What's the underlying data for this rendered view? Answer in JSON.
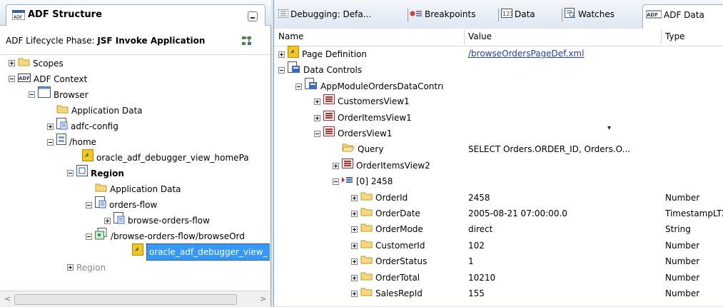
{
  "left_panel": {
    "tab_title": "ADF Structure",
    "phase_label": "ADF Lifecycle Phase: ",
    "phase_value": "JSF Invoke Application",
    "tree": [
      {
        "label": "Scopes",
        "expander": "plus",
        "icon": "folder"
      },
      {
        "label": "ADF Context",
        "expander": "minus",
        "icon": "adf"
      },
      {
        "label": "Browser",
        "expander": "minus",
        "icon": "window"
      },
      {
        "label": "Application Data",
        "expander": "none",
        "icon": "folder"
      },
      {
        "label": "adfc-config",
        "expander": "plus",
        "icon": "taskflow"
      },
      {
        "label": "/home",
        "expander": "minus",
        "icon": "page"
      },
      {
        "label": "oracle_adf_debugger_view_homePa",
        "expander": "none",
        "icon": "pagedef"
      },
      {
        "label": "Region",
        "expander": "minus",
        "icon": "region"
      },
      {
        "label": "Application Data",
        "expander": "none",
        "icon": "folder"
      },
      {
        "label": "orders-flow",
        "expander": "minus",
        "icon": "taskflow"
      },
      {
        "label": "browse-orders-flow",
        "expander": "plus",
        "icon": "taskflow"
      },
      {
        "label": "/browse-orders-flow/browseOrd",
        "expander": "minus",
        "icon": "pagefrag"
      },
      {
        "label": "oracle_adf_debugger_view_",
        "expander": "none",
        "icon": "pagedef"
      },
      {
        "label": "Region",
        "expander": "plus",
        "icon": "none"
      }
    ]
  },
  "right_panel": {
    "tabs": [
      "Debugging: Defa...",
      "Breakpoints",
      "Data",
      "Watches",
      "ADF Data"
    ],
    "columns": [
      "Name",
      "Value",
      "Type"
    ],
    "rows": [
      {
        "name": "Page Definition",
        "value": "/browseOrdersPageDef.xml",
        "type": "",
        "icon": "pagedef",
        "expander": "plus"
      },
      {
        "name": "Data Controls",
        "value": "",
        "type": "",
        "icon": "datacontrols",
        "expander": "minus"
      },
      {
        "name": "AppModuleOrdersDataContrı",
        "value": "",
        "type": "",
        "icon": "datacontrols",
        "expander": "minus"
      },
      {
        "name": "CustomersView1",
        "value": "",
        "type": "",
        "icon": "view",
        "expander": "plus"
      },
      {
        "name": "OrderItemsView1",
        "value": "",
        "type": "",
        "icon": "view",
        "expander": "plus"
      },
      {
        "name": "OrdersView1",
        "value": "",
        "type": "",
        "icon": "view",
        "expander": "minus"
      },
      {
        "name": "Query",
        "value": "SELECT Orders.ORDER_ID, Orders.O...",
        "type": "",
        "icon": "openfolder",
        "expander": "none"
      },
      {
        "name": "OrderItemsView2",
        "value": "",
        "type": "",
        "icon": "view",
        "expander": "plus"
      },
      {
        "name": "[0] 2458",
        "value": "",
        "type": "",
        "icon": "rowlist",
        "expander": "minus"
      },
      {
        "name": "OrderId",
        "value": "2458",
        "type": "Number",
        "icon": "folder",
        "expander": "plus"
      },
      {
        "name": "OrderDate",
        "value": "2005-08-21 07:00:00.0",
        "type": "TimestampLTZ",
        "icon": "folder",
        "expander": "plus"
      },
      {
        "name": "OrderMode",
        "value": "direct",
        "type": "String",
        "icon": "folder",
        "expander": "plus"
      },
      {
        "name": "CustomerId",
        "value": "102",
        "type": "Number",
        "icon": "folder",
        "expander": "plus"
      },
      {
        "name": "OrderStatus",
        "value": "1",
        "type": "Number",
        "icon": "folder",
        "expander": "plus"
      },
      {
        "name": "OrderTotal",
        "value": "10210",
        "type": "Number",
        "icon": "folder",
        "expander": "plus"
      },
      {
        "name": "SalesRepId",
        "value": "155",
        "type": "Number",
        "icon": "folder",
        "expander": "plus"
      }
    ]
  }
}
